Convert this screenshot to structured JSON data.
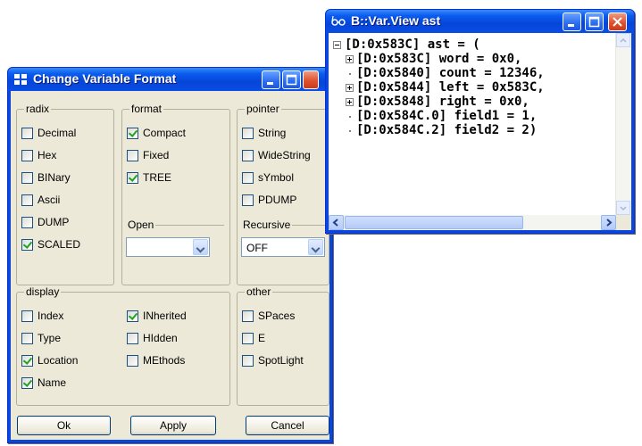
{
  "dialog": {
    "title": "Change Variable Format",
    "groups": {
      "radix": {
        "label": "radix",
        "items": [
          {
            "label": "Decimal",
            "checked": false
          },
          {
            "label": "Hex",
            "checked": false
          },
          {
            "label": "BINary",
            "checked": false
          },
          {
            "label": "Ascii",
            "checked": false
          },
          {
            "label": "DUMP",
            "checked": false
          },
          {
            "label": "SCALED",
            "checked": true
          }
        ]
      },
      "format": {
        "label": "format",
        "items": [
          {
            "label": "Compact",
            "checked": true
          },
          {
            "label": "Fixed",
            "checked": false
          },
          {
            "label": "TREE",
            "checked": true
          }
        ],
        "open_label": "Open",
        "open_value": ""
      },
      "pointer": {
        "label": "pointer",
        "items": [
          {
            "label": "String",
            "checked": false
          },
          {
            "label": "WideString",
            "checked": false
          },
          {
            "label": "sYmbol",
            "checked": false
          },
          {
            "label": "PDUMP",
            "checked": false
          }
        ],
        "recursive_label": "Recursive",
        "recursive_value": "OFF"
      },
      "display": {
        "label": "display",
        "items": [
          {
            "label": "Index",
            "checked": false
          },
          {
            "label": "Type",
            "checked": false
          },
          {
            "label": "Location",
            "checked": true
          },
          {
            "label": "Name",
            "checked": true
          },
          {
            "label": "INherited",
            "checked": true
          },
          {
            "label": "HIdden",
            "checked": false
          },
          {
            "label": "MEthods",
            "checked": false
          }
        ]
      },
      "other": {
        "label": "other",
        "items": [
          {
            "label": "SPaces",
            "checked": false
          },
          {
            "label": "E",
            "checked": false
          },
          {
            "label": "SpotLight",
            "checked": false
          }
        ]
      }
    },
    "buttons": {
      "ok": "Ok",
      "apply": "Apply",
      "cancel": "Cancel"
    }
  },
  "varview": {
    "title": "B::Var.View ast",
    "lines": [
      "[D:0x583C] ast = (",
      "[D:0x583C] word = 0x0,",
      "[D:0x5840] count = 12346,",
      "[D:0x5844] left = 0x583C,",
      "[D:0x5848] right = 0x0,",
      "[D:0x584C.0] field1 = 1,",
      "[D:0x584C.2] field2 = 2)"
    ]
  }
}
